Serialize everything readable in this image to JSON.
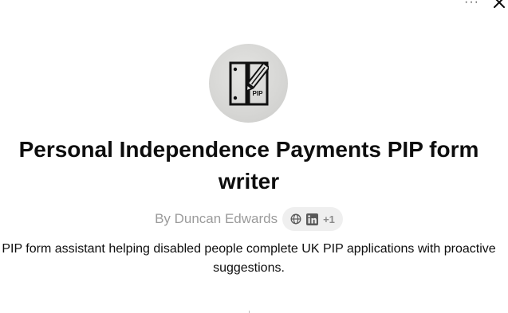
{
  "gpt": {
    "title": "Personal Independence Payments PIP form writer",
    "author": "By Duncan Edwards",
    "description": "PIP form assistant helping disabled people complete UK PIP applications with proactive suggestions.",
    "avatar_icon": "pip-form-pencil-icon",
    "avatar_label": "PIP"
  },
  "links": {
    "icons": [
      "globe-icon",
      "linkedin-icon"
    ],
    "extra_count": "+1"
  },
  "controls": {
    "more_label": "···",
    "close_icon": "close-icon"
  }
}
